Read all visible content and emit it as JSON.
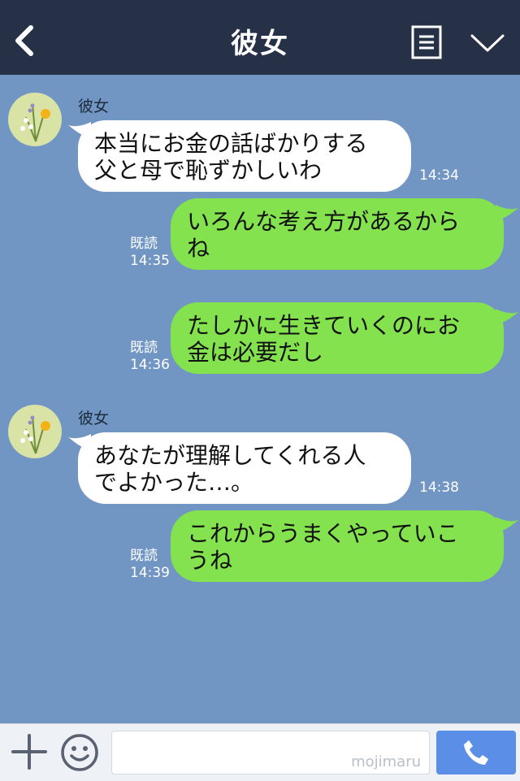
{
  "header": {
    "title": "彼女",
    "icons": [
      "back-icon",
      "menu-icon",
      "chevron-down-icon"
    ],
    "background": "#263046"
  },
  "chat": {
    "background": "#7196c4",
    "messages": [
      {
        "direction": "in",
        "sender": "彼女",
        "lines": [
          "本当にお金の話ばかりする",
          "父と母で恥ずかしいわ"
        ],
        "time": "14:34"
      },
      {
        "direction": "out",
        "read": "既読",
        "lines": [
          "いろんな考え方があるから",
          "ね"
        ],
        "time": "14:35"
      },
      {
        "direction": "out",
        "read": "既読",
        "lines": [
          "たしかに生きていくのにお",
          "金は必要だし"
        ],
        "time": "14:36"
      },
      {
        "direction": "in",
        "sender": "彼女",
        "lines": [
          "あなたが理解してくれる人",
          "でよかった…。"
        ],
        "time": "14:38"
      },
      {
        "direction": "out",
        "read": "既読",
        "lines": [
          "これからうまくやっていこ",
          "うね"
        ],
        "time": "14:39"
      }
    ]
  },
  "footer": {
    "input_value": "",
    "watermark": "mojimaru",
    "icons": [
      "plus-icon",
      "emoji-icon",
      "phone-icon"
    ],
    "call_color": "#5b8ee6"
  },
  "colors": {
    "out_bubble": "#83e24e",
    "in_bubble": "#ffffff"
  }
}
